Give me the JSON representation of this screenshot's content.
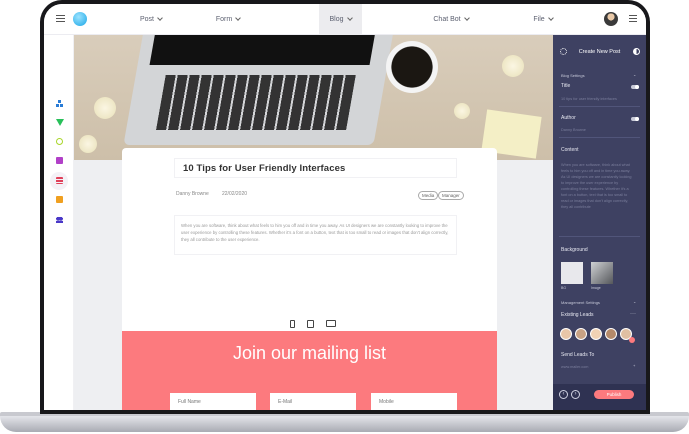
{
  "topbar": {
    "nav": [
      {
        "label": "Post"
      },
      {
        "label": "Form"
      },
      {
        "label": "Blog"
      },
      {
        "label": "Chat Bot"
      },
      {
        "label": "File"
      }
    ]
  },
  "post": {
    "title": "10 Tips for User Friendly Interfaces",
    "author": "Danny Browne",
    "date": "22/02/2020",
    "tags": [
      "Media",
      "Manager"
    ],
    "body": "When you are software, think about what feels to him you off and in time you away. As UI designers we are constantly looking to improve the user experience by controlling these features. Whether it's a font on a button, text that is too small to read or images that don't align correctly, they all contribute to the user experience."
  },
  "mailing": {
    "title": "Join our mailing list",
    "fields": [
      "Full Name",
      "E-Mail",
      "Mobile"
    ]
  },
  "panel": {
    "header": "Create New Post",
    "blog_settings": "Blog Settings",
    "title_label": "Title",
    "title_placeholder": "10 tips for user friendly interfaces",
    "author_label": "Author",
    "author_placeholder": "Danny Browne",
    "content_label": "Content",
    "content_text": "When you are software, think about what feels to him you off and in time you away. As UI designers we are constantly looking to improve the user experience by controlling these features. Whether it's a font on a button, text that is too small to read or images that don't align correctly, they all contribute",
    "background_label": "Background",
    "bg_options": [
      "BG",
      "Image"
    ],
    "management": "Management Settings",
    "existing_leads": "Existing Leads",
    "send_leads": "Send Leads To",
    "send_placeholder": "www.mailer.com",
    "publish": "Publish"
  },
  "colors": {
    "accent": "#fc7a7e",
    "panel": "#3e4162"
  }
}
